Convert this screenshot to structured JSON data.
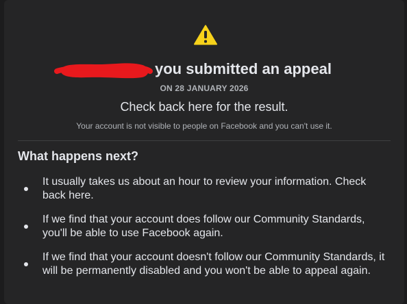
{
  "colors": {
    "background": "#1c1c1d",
    "card": "#252526",
    "warning": "#f7d21b",
    "redaction": "#e8191d",
    "text_primary": "#e4e6eb",
    "text_secondary": "#b0b3b8"
  },
  "icons": {
    "warning": "warning-triangle-icon"
  },
  "header": {
    "title": "you submitted an appeal",
    "date": "ON 28 JANUARY 2026",
    "check_back": "Check back here for the result.",
    "visibility_note": "Your account is not visible to people on Facebook and you can't use it."
  },
  "next": {
    "title": "What happens next?",
    "steps": [
      "It usually takes us about an hour to review your information. Check back here.",
      "If we find that your account does follow our Community Standards, you'll be able to use Facebook again.",
      "If we find that your account doesn't follow our Community Standards, it will be permanently disabled and you won't be able to appeal again."
    ]
  }
}
